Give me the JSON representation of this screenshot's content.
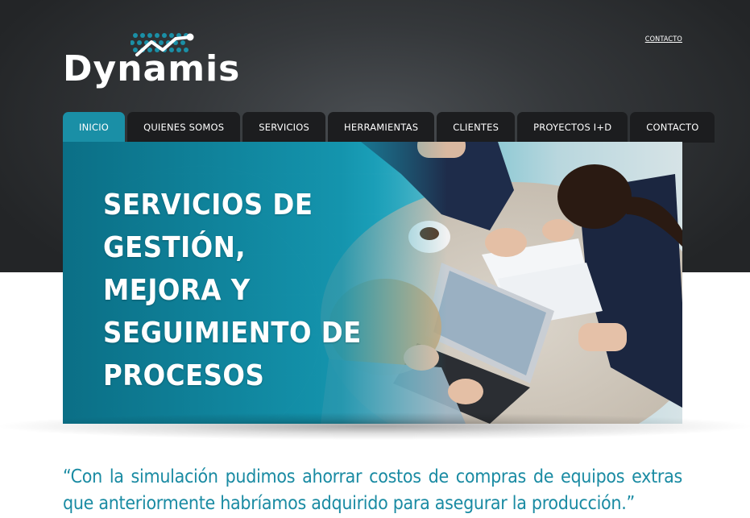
{
  "brand": {
    "name": "Dynamis"
  },
  "header": {
    "contact_link": "CONTACTO"
  },
  "nav": {
    "tabs": [
      {
        "label": "INICIO",
        "active": true
      },
      {
        "label": "QUIENES SOMOS",
        "active": false
      },
      {
        "label": "SERVICIOS",
        "active": false
      },
      {
        "label": "HERRAMIENTAS",
        "active": false
      },
      {
        "label": "CLIENTES",
        "active": false
      },
      {
        "label": "PROYECTOS I+D",
        "active": false
      },
      {
        "label": "CONTACTO",
        "active": false
      }
    ]
  },
  "hero": {
    "title": "SERVICIOS DE GESTIÓN, MEJORA Y SEGUIMIENTO DE PROCESOS",
    "image": "business-meeting-photo"
  },
  "testimonial": {
    "quote": "“Con la simulación pudimos ahorrar costos de compras de equipos extras que anteriormente habríamos adquirido para asegurar la producción.”"
  },
  "colors": {
    "accent": "#1a8fa6",
    "dark_background": "#2e3134",
    "tab_background": "#1c1d1f",
    "quote_text": "#1a8ba3"
  }
}
